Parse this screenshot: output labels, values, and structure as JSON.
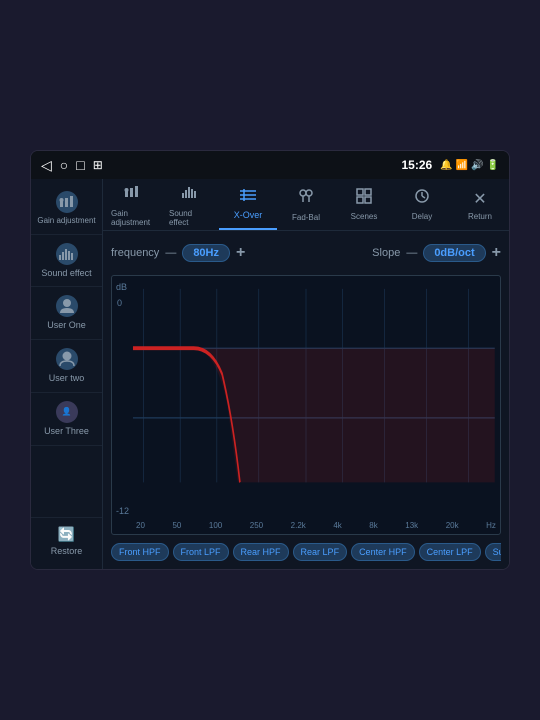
{
  "statusBar": {
    "time": "15:26",
    "icons": [
      "📶",
      "🔔",
      "📶",
      "🔊",
      "🔋"
    ]
  },
  "sidebar": {
    "items": [
      {
        "id": "gain-adjustment",
        "label": "Gain adjustment",
        "icon": "🔊"
      },
      {
        "id": "sound-effect",
        "label": "Sound effect",
        "icon": "📊"
      },
      {
        "id": "user-one",
        "label": "User One",
        "isUser": true
      },
      {
        "id": "user-two",
        "label": "User two",
        "isUser": true
      },
      {
        "id": "user-three",
        "label": "User Three",
        "isUser": true
      }
    ],
    "restoreLabel": "Restore"
  },
  "topNav": {
    "tabs": [
      {
        "id": "gain-adj",
        "label": "Gain adjustment",
        "icon": "🔊",
        "active": false
      },
      {
        "id": "sound-effect",
        "label": "Sound effect",
        "icon": "📊",
        "active": false
      },
      {
        "id": "x-over",
        "label": "X-Over",
        "icon": "≡",
        "active": true
      },
      {
        "id": "fad-bal",
        "label": "Fad-Bal",
        "icon": "🎛",
        "active": false
      },
      {
        "id": "scenes",
        "label": "Scenes",
        "icon": "⊞",
        "active": false
      },
      {
        "id": "delay",
        "label": "Delay",
        "icon": "⏱",
        "active": false
      },
      {
        "id": "return",
        "label": "Return",
        "icon": "✕",
        "active": false
      }
    ]
  },
  "controls": {
    "frequency": {
      "label": "frequency",
      "value": "80Hz"
    },
    "slope": {
      "label": "Slope",
      "value": "0dB/oct"
    }
  },
  "graph": {
    "yAxisLabels": [
      "dB",
      "0",
      "-12"
    ],
    "xAxisLabels": [
      "20",
      "50",
      "100",
      "250",
      "2.2k",
      "4k",
      "8k",
      "13k",
      "20k",
      "Hz"
    ]
  },
  "filterButtons": [
    "Front HPF",
    "Front LPF",
    "Rear HPF",
    "Rear LPF",
    "Center HPF",
    "Center LPF",
    "Subwoofer."
  ]
}
